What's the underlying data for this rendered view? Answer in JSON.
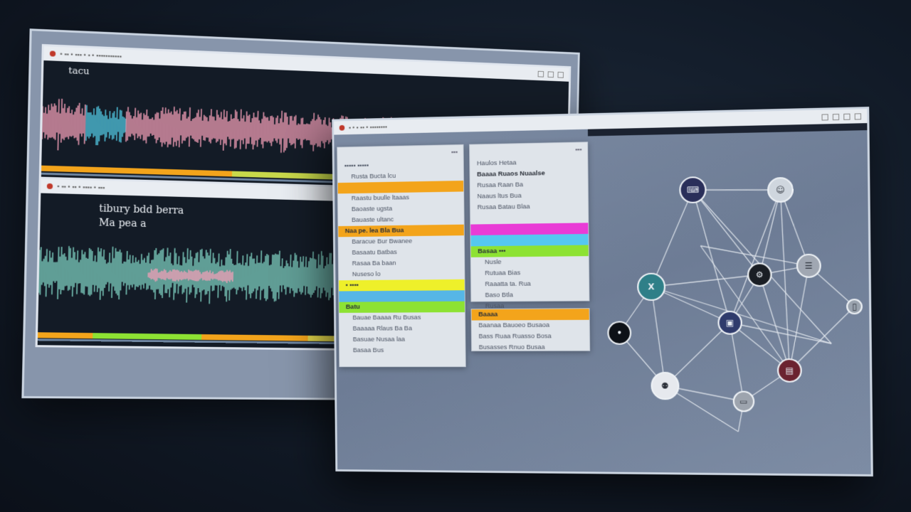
{
  "back_window": {
    "panel1": {
      "title": "• ▪▪ • ▪▪▪ • ▪ • ▪▪▪▪▪▪▪▪▪▪▪",
      "label": "tacu"
    },
    "panel2": {
      "title": "• ▪▪ • ▪▪ • ▪▪▪▪ • ▪▪▪",
      "label_line1": "tibury bdd berra",
      "label_line2": "Ma pea a"
    }
  },
  "front_window": {
    "title": "▪ • ▪ ▪▪ • ▪▪▪▪▪▪▪▪",
    "left_panel": {
      "header": "▪▪▪",
      "rows": [
        {
          "text": "▪▪▪▪▪ ▪▪▪▪▪",
          "style": ""
        },
        {
          "text": "Rusta Bucta lcu",
          "style": "indent"
        },
        {
          "text": "",
          "style": "band band-orange"
        },
        {
          "text": "Raastu buulle ltaaas",
          "style": "indent"
        },
        {
          "text": "Baoaste ugsta",
          "style": "indent"
        },
        {
          "text": "Bauaste ultanc",
          "style": "indent"
        },
        {
          "text": "Naa pe. lea Bla Bua",
          "style": "band band-orange"
        },
        {
          "text": "Baracue Bur Bwanee",
          "style": "indent"
        },
        {
          "text": "Basaatu Batbas",
          "style": "indent"
        },
        {
          "text": "Rasaa Ba baan",
          "style": "indent"
        },
        {
          "text": "Nuseso lo",
          "style": "indent"
        },
        {
          "text": "▪ ▪▪▪▪",
          "style": "band band-yellow"
        },
        {
          "text": "",
          "style": "band band-blue"
        },
        {
          "text": "Batu",
          "style": "band band-green"
        },
        {
          "text": "Bauae Baaaa Ru Busas",
          "style": "indent"
        },
        {
          "text": "Baaaaa Rlaus Ba Ba",
          "style": "indent"
        },
        {
          "text": "Basuae Nusaa laa",
          "style": "indent"
        },
        {
          "text": "Basaa Bus",
          "style": "indent"
        }
      ]
    },
    "mid_panel": {
      "header": "▪▪▪",
      "rows": [
        {
          "text": "Haulos Hetaa",
          "style": ""
        },
        {
          "text": "Baaaa Ruaos Nuaalse",
          "style": "band"
        },
        {
          "text": "Rusaa Raan Ba",
          "style": ""
        },
        {
          "text": "Naaus ltus Bua",
          "style": ""
        },
        {
          "text": "Rusaa Batau Blaa",
          "style": ""
        },
        {
          "text": "",
          "style": ""
        },
        {
          "text": "",
          "style": "band band-magenta"
        },
        {
          "text": "",
          "style": "band band-cyan"
        },
        {
          "text": "Basaa ▪▪▪",
          "style": "band band-green"
        },
        {
          "text": "Nusle",
          "style": "indent"
        },
        {
          "text": "Rutuaa Bias",
          "style": "indent"
        },
        {
          "text": "Raaatta ta. Rua",
          "style": "indent"
        },
        {
          "text": "Baso Btla",
          "style": "indent"
        },
        {
          "text": "Rusaa",
          "style": "indent"
        }
      ]
    },
    "mid2_panel": {
      "rows": [
        {
          "text": "Baaaa",
          "style": "band band-orange"
        },
        {
          "text": "Baanaa Bauoeo Busaoa",
          "style": ""
        },
        {
          "text": "Bass Ruaa Ruasso Bosa",
          "style": ""
        },
        {
          "text": "Busasses Rnuo Busaa",
          "style": ""
        }
      ]
    },
    "graph": {
      "node_icons": [
        "keyboard-icon",
        "person-icon",
        "x-icon",
        "gear-icon",
        "grid-icon",
        "dot-icon",
        "monitor-icon",
        "person-cluster-icon",
        "folder-icon",
        "tag-icon",
        "file-icon"
      ]
    }
  },
  "colors": {
    "wave_pink": "#f49fb8",
    "wave_cyan": "#52c9e3",
    "wave_teal": "#7fd1c2",
    "accent_orange": "#f3a41b",
    "accent_yellow": "#eef02a",
    "accent_green": "#8de233",
    "accent_magenta": "#e93bd6"
  }
}
